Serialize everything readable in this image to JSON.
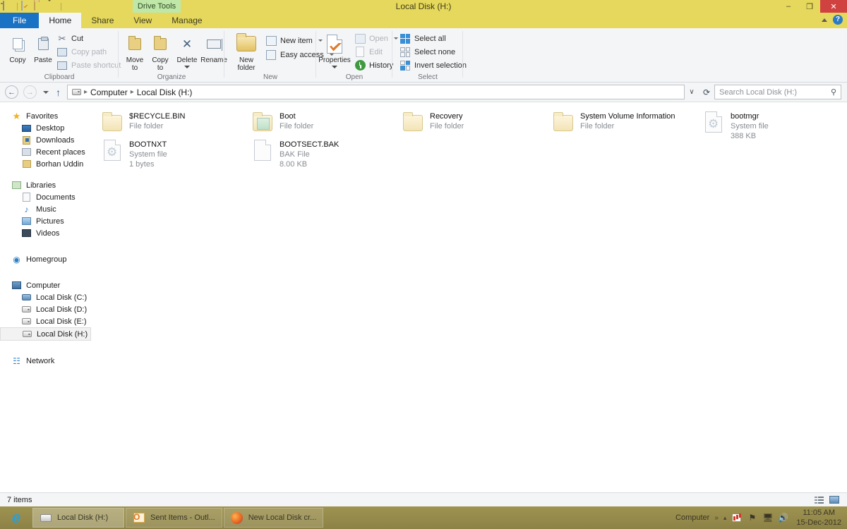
{
  "window": {
    "title": "Local Disk (H:)",
    "contextual_tab_label": "Drive Tools",
    "minimize_label": "–",
    "maximize_label": "❐",
    "close_label": "✕",
    "collapse_ribbon_label": "",
    "help_label": "?"
  },
  "quick_access": {
    "items": [
      {
        "name": "drive-icon",
        "label": ""
      },
      {
        "name": "properties-icon",
        "label": ""
      },
      {
        "name": "new-folder-icon",
        "label": ""
      },
      {
        "name": "customize-caret-icon",
        "label": ""
      }
    ]
  },
  "tabs": [
    {
      "id": "file",
      "label": "File",
      "state": "file"
    },
    {
      "id": "home",
      "label": "Home",
      "state": "active"
    },
    {
      "id": "share",
      "label": "Share",
      "state": "inactive"
    },
    {
      "id": "view",
      "label": "View",
      "state": "inactive"
    },
    {
      "id": "manage",
      "label": "Manage",
      "state": "inactive"
    }
  ],
  "ribbon": {
    "groups": [
      {
        "id": "clipboard",
        "label": "Clipboard"
      },
      {
        "id": "organize",
        "label": "Organize"
      },
      {
        "id": "new",
        "label": "New"
      },
      {
        "id": "open",
        "label": "Open"
      },
      {
        "id": "select",
        "label": "Select"
      }
    ],
    "clipboard": {
      "copy": "Copy",
      "paste": "Paste",
      "cut": "Cut",
      "copy_path": "Copy path",
      "paste_shortcut": "Paste shortcut"
    },
    "organize": {
      "move_to": "Move\nto",
      "move_to_line1": "Move",
      "move_to_line2": "to",
      "copy_to_line1": "Copy",
      "copy_to_line2": "to",
      "delete": "Delete",
      "rename": "Rename"
    },
    "new": {
      "new_folder_line1": "New",
      "new_folder_line2": "folder",
      "new_item": "New item",
      "easy_access": "Easy access"
    },
    "open": {
      "properties": "Properties",
      "open": "Open",
      "edit": "Edit",
      "history": "History"
    },
    "select": {
      "select_all": "Select all",
      "select_none": "Select none",
      "invert_selection": "Invert selection"
    }
  },
  "address_bar": {
    "back_label": "←",
    "forward_label": "→",
    "recent_caret": "",
    "up_label": "↑",
    "breadcrumb": [
      "Computer",
      "Local Disk (H:)"
    ],
    "breadcrumb_separator": "▸",
    "dropdown_caret": "∨",
    "refresh_label": "⟳",
    "search_placeholder": "Search Local Disk (H:)",
    "search_value": "",
    "search_icon": "⚲"
  },
  "nav_pane": {
    "sections": [
      {
        "header": {
          "label": "Favorites",
          "icon": "star-icon"
        },
        "items": [
          {
            "label": "Desktop",
            "icon": "desktop-icon"
          },
          {
            "label": "Downloads",
            "icon": "downloads-icon"
          },
          {
            "label": "Recent places",
            "icon": "recent-places-icon"
          },
          {
            "label": "Borhan Uddin",
            "icon": "user-folder-icon"
          }
        ]
      },
      {
        "header": {
          "label": "Libraries",
          "icon": "libraries-icon"
        },
        "items": [
          {
            "label": "Documents",
            "icon": "documents-icon"
          },
          {
            "label": "Music",
            "icon": "music-icon"
          },
          {
            "label": "Pictures",
            "icon": "pictures-icon"
          },
          {
            "label": "Videos",
            "icon": "videos-icon"
          }
        ]
      },
      {
        "header": {
          "label": "Homegroup",
          "icon": "homegroup-icon"
        },
        "items": []
      },
      {
        "header": {
          "label": "Computer",
          "icon": "computer-icon"
        },
        "items": [
          {
            "label": "Local Disk (C:)",
            "icon": "system-drive-icon",
            "selected": false
          },
          {
            "label": "Local Disk (D:)",
            "icon": "drive-icon",
            "selected": false
          },
          {
            "label": "Local Disk (E:)",
            "icon": "drive-icon",
            "selected": false
          },
          {
            "label": "Local Disk (H:)",
            "icon": "drive-icon",
            "selected": true
          }
        ]
      },
      {
        "header": {
          "label": "Network",
          "icon": "network-icon"
        },
        "items": []
      }
    ]
  },
  "files": [
    {
      "name": "$RECYCLE.BIN",
      "type": "File folder",
      "size": "",
      "icon": "folder-icon"
    },
    {
      "name": "Boot",
      "type": "File folder",
      "size": "",
      "icon": "folder-open-icon"
    },
    {
      "name": "Recovery",
      "type": "File folder",
      "size": "",
      "icon": "folder-icon"
    },
    {
      "name": "System Volume Information",
      "type": "File folder",
      "size": "",
      "icon": "folder-icon"
    },
    {
      "name": "bootmgr",
      "type": "System file",
      "size": "388 KB",
      "icon": "system-file-icon"
    },
    {
      "name": "BOOTNXT",
      "type": "System file",
      "size": "1 bytes",
      "icon": "system-file-icon"
    },
    {
      "name": "BOOTSECT.BAK",
      "type": "BAK File",
      "size": "8.00 KB",
      "icon": "bak-file-icon"
    }
  ],
  "status_bar": {
    "item_count": "7 items",
    "details_view_label": "",
    "thumbnail_view_label": ""
  },
  "taskbar": {
    "start_icon": "internet-explorer-icon",
    "buttons": [
      {
        "label": "Local Disk (H:)",
        "icon": "drive-icon",
        "active": true
      },
      {
        "label": "Sent Items - Outl...",
        "icon": "outlook-icon",
        "active": false
      },
      {
        "label": "New Local Disk cr...",
        "icon": "firefox-icon",
        "active": false
      }
    ],
    "tray": {
      "label": "Computer",
      "overflow_caret": "»",
      "show_hidden": "▴",
      "icons": [
        "action-center-icon",
        "flag-icon",
        "network-icon",
        "volume-icon"
      ],
      "time": "11:05 AM",
      "date": "15-Dec-2012"
    }
  },
  "colors": {
    "titlebar": "#e6d85c",
    "contextual_tab": "#bfe8a8",
    "file_tab": "#1a72c4",
    "ribbon_bg": "#f4f5f7",
    "close_button": "#cf4240",
    "taskbar": "#9e9350"
  }
}
